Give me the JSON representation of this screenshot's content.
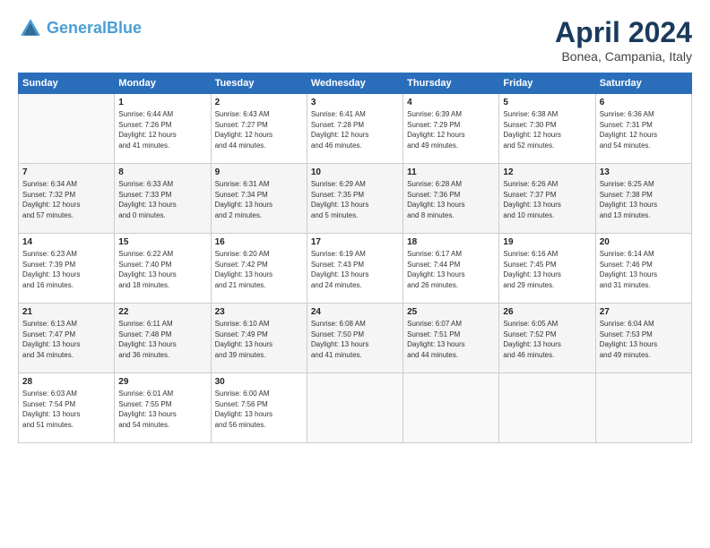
{
  "header": {
    "logo_line1": "General",
    "logo_line2": "Blue",
    "title": "April 2024",
    "subtitle": "Bonea, Campania, Italy"
  },
  "columns": [
    "Sunday",
    "Monday",
    "Tuesday",
    "Wednesday",
    "Thursday",
    "Friday",
    "Saturday"
  ],
  "weeks": [
    [
      {
        "day": "",
        "text": ""
      },
      {
        "day": "1",
        "text": "Sunrise: 6:44 AM\nSunset: 7:26 PM\nDaylight: 12 hours\nand 41 minutes."
      },
      {
        "day": "2",
        "text": "Sunrise: 6:43 AM\nSunset: 7:27 PM\nDaylight: 12 hours\nand 44 minutes."
      },
      {
        "day": "3",
        "text": "Sunrise: 6:41 AM\nSunset: 7:28 PM\nDaylight: 12 hours\nand 46 minutes."
      },
      {
        "day": "4",
        "text": "Sunrise: 6:39 AM\nSunset: 7:29 PM\nDaylight: 12 hours\nand 49 minutes."
      },
      {
        "day": "5",
        "text": "Sunrise: 6:38 AM\nSunset: 7:30 PM\nDaylight: 12 hours\nand 52 minutes."
      },
      {
        "day": "6",
        "text": "Sunrise: 6:36 AM\nSunset: 7:31 PM\nDaylight: 12 hours\nand 54 minutes."
      }
    ],
    [
      {
        "day": "7",
        "text": "Sunrise: 6:34 AM\nSunset: 7:32 PM\nDaylight: 12 hours\nand 57 minutes."
      },
      {
        "day": "8",
        "text": "Sunrise: 6:33 AM\nSunset: 7:33 PM\nDaylight: 13 hours\nand 0 minutes."
      },
      {
        "day": "9",
        "text": "Sunrise: 6:31 AM\nSunset: 7:34 PM\nDaylight: 13 hours\nand 2 minutes."
      },
      {
        "day": "10",
        "text": "Sunrise: 6:29 AM\nSunset: 7:35 PM\nDaylight: 13 hours\nand 5 minutes."
      },
      {
        "day": "11",
        "text": "Sunrise: 6:28 AM\nSunset: 7:36 PM\nDaylight: 13 hours\nand 8 minutes."
      },
      {
        "day": "12",
        "text": "Sunrise: 6:26 AM\nSunset: 7:37 PM\nDaylight: 13 hours\nand 10 minutes."
      },
      {
        "day": "13",
        "text": "Sunrise: 6:25 AM\nSunset: 7:38 PM\nDaylight: 13 hours\nand 13 minutes."
      }
    ],
    [
      {
        "day": "14",
        "text": "Sunrise: 6:23 AM\nSunset: 7:39 PM\nDaylight: 13 hours\nand 16 minutes."
      },
      {
        "day": "15",
        "text": "Sunrise: 6:22 AM\nSunset: 7:40 PM\nDaylight: 13 hours\nand 18 minutes."
      },
      {
        "day": "16",
        "text": "Sunrise: 6:20 AM\nSunset: 7:42 PM\nDaylight: 13 hours\nand 21 minutes."
      },
      {
        "day": "17",
        "text": "Sunrise: 6:19 AM\nSunset: 7:43 PM\nDaylight: 13 hours\nand 24 minutes."
      },
      {
        "day": "18",
        "text": "Sunrise: 6:17 AM\nSunset: 7:44 PM\nDaylight: 13 hours\nand 26 minutes."
      },
      {
        "day": "19",
        "text": "Sunrise: 6:16 AM\nSunset: 7:45 PM\nDaylight: 13 hours\nand 29 minutes."
      },
      {
        "day": "20",
        "text": "Sunrise: 6:14 AM\nSunset: 7:46 PM\nDaylight: 13 hours\nand 31 minutes."
      }
    ],
    [
      {
        "day": "21",
        "text": "Sunrise: 6:13 AM\nSunset: 7:47 PM\nDaylight: 13 hours\nand 34 minutes."
      },
      {
        "day": "22",
        "text": "Sunrise: 6:11 AM\nSunset: 7:48 PM\nDaylight: 13 hours\nand 36 minutes."
      },
      {
        "day": "23",
        "text": "Sunrise: 6:10 AM\nSunset: 7:49 PM\nDaylight: 13 hours\nand 39 minutes."
      },
      {
        "day": "24",
        "text": "Sunrise: 6:08 AM\nSunset: 7:50 PM\nDaylight: 13 hours\nand 41 minutes."
      },
      {
        "day": "25",
        "text": "Sunrise: 6:07 AM\nSunset: 7:51 PM\nDaylight: 13 hours\nand 44 minutes."
      },
      {
        "day": "26",
        "text": "Sunrise: 6:05 AM\nSunset: 7:52 PM\nDaylight: 13 hours\nand 46 minutes."
      },
      {
        "day": "27",
        "text": "Sunrise: 6:04 AM\nSunset: 7:53 PM\nDaylight: 13 hours\nand 49 minutes."
      }
    ],
    [
      {
        "day": "28",
        "text": "Sunrise: 6:03 AM\nSunset: 7:54 PM\nDaylight: 13 hours\nand 51 minutes."
      },
      {
        "day": "29",
        "text": "Sunrise: 6:01 AM\nSunset: 7:55 PM\nDaylight: 13 hours\nand 54 minutes."
      },
      {
        "day": "30",
        "text": "Sunrise: 6:00 AM\nSunset: 7:56 PM\nDaylight: 13 hours\nand 56 minutes."
      },
      {
        "day": "",
        "text": ""
      },
      {
        "day": "",
        "text": ""
      },
      {
        "day": "",
        "text": ""
      },
      {
        "day": "",
        "text": ""
      }
    ]
  ]
}
